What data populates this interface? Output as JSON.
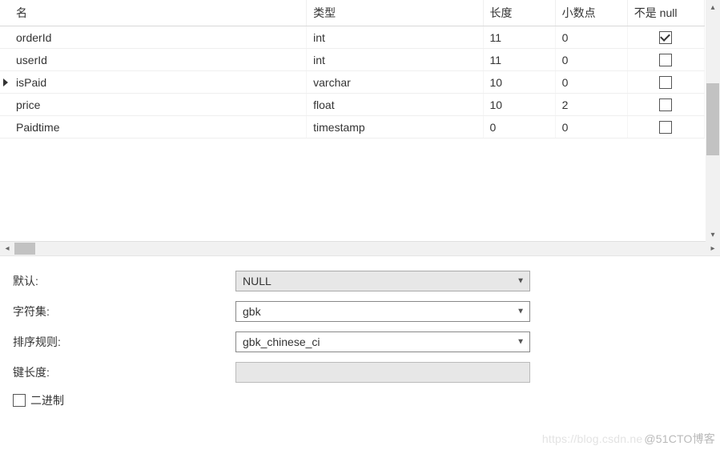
{
  "columns": {
    "name": "名",
    "type": "类型",
    "length": "长度",
    "decimal": "小数点",
    "notnull": "不是 null"
  },
  "rows": [
    {
      "name": "orderId",
      "type": "int",
      "length": "11",
      "decimal": "0",
      "notnull": true,
      "active": false
    },
    {
      "name": "userId",
      "type": "int",
      "length": "11",
      "decimal": "0",
      "notnull": false,
      "active": false
    },
    {
      "name": "isPaid",
      "type": "varchar",
      "length": "10",
      "decimal": "0",
      "notnull": false,
      "active": true
    },
    {
      "name": "price",
      "type": "float",
      "length": "10",
      "decimal": "2",
      "notnull": false,
      "active": false
    },
    {
      "name": "Paidtime",
      "type": "timestamp",
      "length": "0",
      "decimal": "0",
      "notnull": false,
      "active": false
    }
  ],
  "detail": {
    "default_label": "默认:",
    "default_value": "NULL",
    "charset_label": "字符集:",
    "charset_value": "gbk",
    "collation_label": "排序规则:",
    "collation_value": "gbk_chinese_ci",
    "keylen_label": "键长度:",
    "keylen_value": "",
    "binary_label": "二进制",
    "binary_checked": false
  },
  "watermark": {
    "faint": "https://blog.csdn.ne",
    "text": "@51CTO博客"
  }
}
